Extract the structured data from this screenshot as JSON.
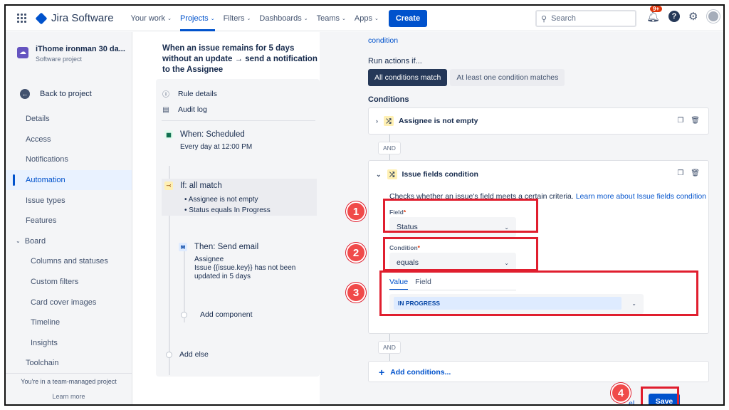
{
  "topnav": {
    "logo": "Jira Software",
    "items": [
      "Your work",
      "Projects",
      "Filters",
      "Dashboards",
      "Teams",
      "Apps"
    ],
    "create": "Create",
    "search_placeholder": "Search",
    "notif_badge": "9+"
  },
  "sidebar": {
    "project_name": "iThome ironman 30 da...",
    "project_type": "Software project",
    "back": "Back to project",
    "items": [
      {
        "label": "Details"
      },
      {
        "label": "Access"
      },
      {
        "label": "Notifications"
      },
      {
        "label": "Automation"
      },
      {
        "label": "Issue types"
      },
      {
        "label": "Features"
      },
      {
        "label": "Board"
      },
      {
        "label": "Columns and statuses"
      },
      {
        "label": "Custom filters"
      },
      {
        "label": "Card cover images"
      },
      {
        "label": "Timeline"
      },
      {
        "label": "Insights"
      },
      {
        "label": "Toolchain"
      }
    ],
    "footer_text": "You're in a team-managed project",
    "footer_link": "Learn more"
  },
  "rule": {
    "title": "When an issue remains for 5 days without an update → send a notification to the Assignee",
    "rule_details": "Rule details",
    "audit_log": "Audit log",
    "trigger_title": "When: Scheduled",
    "trigger_sub": "Every day at 12:00 PM",
    "if_title": "If: all match",
    "if_bullets": [
      "Assignee is not empty",
      "Status equals In Progress"
    ],
    "then_title": "Then: Send email",
    "then_line1": "Assignee",
    "then_line2": "Issue {{issue.key}} has not been updated in 5 days",
    "add_component": "Add component",
    "add_else": "Add else"
  },
  "panel": {
    "condition_link": "condition",
    "run_label": "Run actions if...",
    "seg_all": "All conditions match",
    "seg_any": "At least one condition matches",
    "conditions_heading": "Conditions",
    "cond1": "Assignee is not empty",
    "and_label": "AND",
    "cond2": "Issue fields condition",
    "desc": "Checks whether an issue's field meets a certain criteria.",
    "desc_link": "Learn more about Issue fields condition",
    "field_label": "Field",
    "field_value": "Status",
    "condition_label": "Condition",
    "condition_value": "equals",
    "tab_value": "Value",
    "tab_field": "Field",
    "value_chip": "IN PROGRESS",
    "add_conditions": "Add conditions...",
    "cancel_fragment": "el",
    "save": "Save"
  },
  "annotations": [
    "1",
    "2",
    "3",
    "4"
  ],
  "colors": {
    "accent": "#0052CC",
    "annotation": "#E01E2E",
    "sidebar_bg": "#F4F5F7"
  }
}
